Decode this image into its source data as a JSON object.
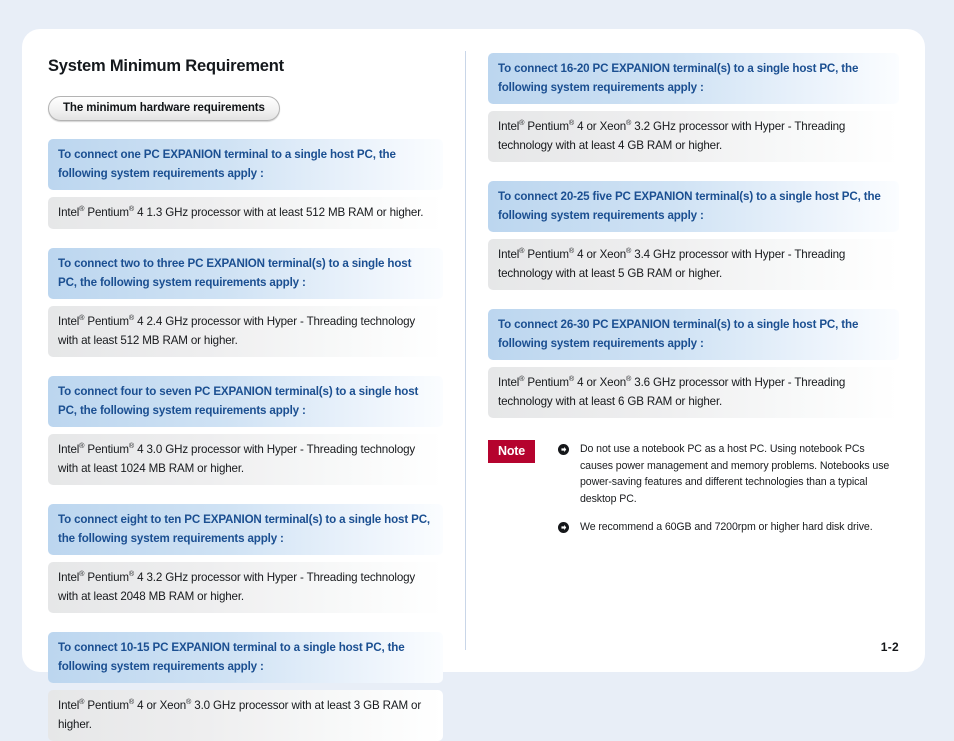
{
  "page": {
    "title": "System Minimum Requirement",
    "pill_label": "The minimum hardware requirements",
    "page_number": "1-2",
    "accent_blue": "#1b4f91",
    "note_badge_color": "#b5032e",
    "background_color": "#e8eef7"
  },
  "left_column": {
    "sections": [
      {
        "heading": "To connect one PC EXPANION terminal to a single host PC, the following system requirements apply :",
        "body": "Intel® Pentium® 4 1.3 GHz processor with at least 512 MB RAM or higher."
      },
      {
        "heading": "To connect two to three PC EXPANION terminal(s) to a single host PC, the following system requirements apply :",
        "body": "Intel® Pentium® 4 2.4 GHz processor with Hyper - Threading technology with at least 512 MB RAM or higher."
      },
      {
        "heading": "To connect four to seven PC EXPANION terminal(s) to a single host PC, the following system requirements apply :",
        "body": "Intel® Pentium® 4 3.0 GHz processor with Hyper - Threading technology with at least 1024 MB RAM or higher."
      },
      {
        "heading": "To connect eight to ten PC EXPANION terminal(s) to a single host PC, the following system requirements apply :",
        "body": "Intel® Pentium® 4 3.2 GHz processor with Hyper - Threading technology with at least 2048 MB RAM or higher."
      },
      {
        "heading": "To connect 10-15 PC EXPANION terminal to a single host PC, the following system requirements apply :",
        "body": "Intel® Pentium® 4 or Xeon® 3.0 GHz processor with at least 3 GB RAM or higher."
      }
    ]
  },
  "right_column": {
    "sections": [
      {
        "heading": "To connect 16-20 PC EXPANION terminal(s) to a single host PC, the following system requirements apply :",
        "body": "Intel® Pentium® 4 or Xeon® 3.2 GHz processor with Hyper - Threading technology with at least 4 GB RAM or higher."
      },
      {
        "heading": "To connect 20-25 five PC EXPANION terminal(s) to a single host PC, the following system requirements apply :",
        "body": "Intel® Pentium® 4 or Xeon® 3.4 GHz processor with Hyper - Threading technology with at least 5 GB RAM or higher."
      },
      {
        "heading": "To connect 26-30 PC EXPANION terminal(s) to a single host PC, the following system requirements apply :",
        "body": "Intel® Pentium® 4 or Xeon® 3.6 GHz processor with Hyper - Threading technology with at least 6 GB RAM or higher."
      }
    ],
    "note": {
      "badge": "Note",
      "items": [
        "Do not use a notebook PC as a host PC. Using notebook PCs causes power management and memory problems. Notebooks use power-saving features and different technologies than a typical desktop PC.",
        "We recommend a 60GB and 7200rpm or higher hard disk drive."
      ]
    }
  }
}
